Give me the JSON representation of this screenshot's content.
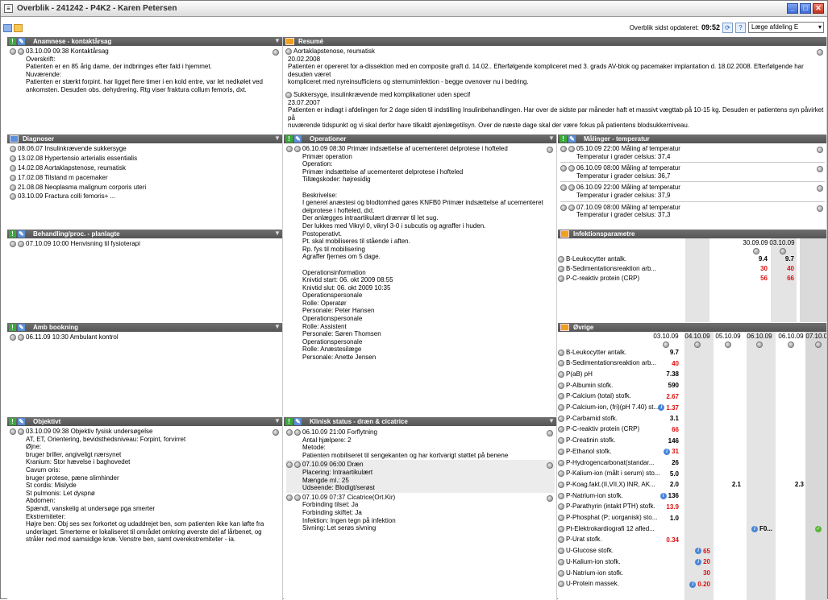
{
  "window": {
    "title": "Overblik - 241242 - P4K2 - Karen Petersen",
    "icon": "form-icon"
  },
  "toolbar": {
    "updated_label": "Overblik sidst opdateret:",
    "updated_time": "09:52",
    "refresh_icon": "refresh-icon",
    "help_label": "?",
    "role_select": "Læge afdeling E"
  },
  "anamnese": {
    "title": "Anamnese - kontaktårsag",
    "head": "03.10.09 09:38 Kontaktårsag",
    "lines": [
      "Overskrift:",
      "Patienten er en 85 årig dame, der indbringes efter fald i hjemmet.",
      "Nuværende:",
      "Patienten er stærkt forpint. har ligget flere timer i en kold entre, var let nedkølet ved",
      "ankomsten. Desuden obs. dehydrering. Rtg viser fraktura collum femoris, dxt."
    ]
  },
  "resume": {
    "title": "Resumé",
    "blocks": [
      {
        "head": "Aortaklapstenose, reumatisk",
        "lines": [
          "20.02.2008",
          "Patienten er opereret for a-dissektion med en composite graft d. 14.02.. Efterfølgende kompliceret med 3. grads AV-blok og pacemaker implantation d. 18.02.2008. Efterfølgende har desuden været",
          "kompliceret med nyreinsufficiens og sternuminfektion - begge ovenover nu i bedring."
        ]
      },
      {
        "head": "Sukkersyge, insulinkrævende med komplikationer uden specif",
        "lines": [
          "23.07.2007",
          "Patienten er indlagt i afdelingen for 2 dage siden til indstilling Insulinbehandlingen. Har over de sidste par måneder haft et massivt vægttab på 10-15 kg. Desuden er patientens syn påvirket på",
          "nuværende tidspunkt og vi skal derfor have tilkaldt øjenlægetilsyn. Over de næste dage skal der være fokus på patientens blodsukkerniveau."
        ]
      }
    ]
  },
  "diagnoser": {
    "title": "Diagnoser",
    "items": [
      "08.06.07 Insulinkrævende sukkersyge",
      "13.02.08 Hypertensio arterialis essentialis",
      "14.02.08 Aortaklapstenose, reumatisk",
      "17.02.08 Tilstand m pacemaker",
      "21.08.08 Neoplasma malignum corporis uteri",
      "03.10.09 Fractura colli femoris+ ..."
    ]
  },
  "operationer": {
    "title": "Operationer",
    "head": "06.10.09 08:30 Primær indsættelse af ucementeret delprotese i hofteled",
    "lines": [
      "Primær operation",
      "Operation:",
      "Primær indsættelse af ucementeret delprotese i hofteled",
      "Tillægskoder: højresidig",
      "",
      "Beskrivelse:",
      "I generel anæstesi og blodtomhed gøres KNFB0 Primær indsættelse af ucementeret",
      "delprotese i hofteled, dxt.",
      "Der anlægges intraartikulært drænrør til let sug.",
      "Der lukkes med Vikryl 0, vikryl 3-0 i subcutis og agraffer i huden.",
      "Postoperativt.",
      "Pt. skal mobiliseres til stående i aften.",
      "Rp. fys til mobilisering",
      "Agraffer fjernes om 5 dage.",
      "",
      "Operationsinformation",
      "Knivtid start: 06. okt 2009 08:55",
      "Knivtid slut: 06. okt 2009 10:35",
      "Operationspersonale",
      "Rolle: Operatør",
      "Personale: Peter Hansen",
      "Operationspersonale",
      "Rolle: Assistent",
      "Personale: Søren Thomsen",
      "Operationspersonale",
      "Rolle: Anæstesilæge",
      "Personale: Anette Jensen"
    ]
  },
  "malinger": {
    "title": "Målinger - temperatur",
    "items": [
      {
        "head": "05.10.09 22:00 Måling af temperatur",
        "detail": "Temperatur i grader celsius: 37,4"
      },
      {
        "head": "06.10.09 08:00 Måling af temperatur",
        "detail": "Temperatur i grader celsius: 36,7"
      },
      {
        "head": "06.10.09 22:00 Måling af temperatur",
        "detail": "Temperatur i grader celsius: 37,9"
      },
      {
        "head": "07.10.09 08:00 Måling af temperatur",
        "detail": "Temperatur i grader celsius: 37,3"
      }
    ]
  },
  "behandling": {
    "title": "Behandling/proc. - planlagte",
    "items": [
      "07.10.09 10:00 Henvisning til fysioterapi"
    ]
  },
  "infektion": {
    "title": "Infektionsparametre",
    "dates": [
      "30.09.09",
      "03.10.09"
    ],
    "rows": [
      {
        "label": "B-Leukocytter antalk.",
        "vals": [
          "9.4",
          "9.7"
        ],
        "red": [
          false,
          false
        ]
      },
      {
        "label": "B-Sedimentationsreaktion arb...",
        "vals": [
          "30",
          "40"
        ],
        "red": [
          true,
          true
        ]
      },
      {
        "label": "P-C-reaktiv protein (CRP)",
        "vals": [
          "56",
          "66"
        ],
        "red": [
          true,
          true
        ]
      }
    ]
  },
  "amb": {
    "title": "Amb bookning",
    "items": [
      "06.11.09 10:30 Ambulant kontrol"
    ]
  },
  "ovrige": {
    "title": "Øvrige",
    "dates": [
      "03.10.09",
      "04.10.09",
      "05.10.09",
      "06.10.09",
      "06.10.09",
      "07.10.09"
    ],
    "rows": [
      {
        "label": "B-Leukocytter antalk.",
        "col": 0,
        "val": "9.7",
        "red": false,
        "info": false
      },
      {
        "label": "B-Sedimentationsreaktion arb...",
        "col": 0,
        "val": "40",
        "red": true,
        "info": false
      },
      {
        "label": "P(aB) pH",
        "col": 0,
        "val": "7.38",
        "red": false,
        "info": false
      },
      {
        "label": "P-Albumin stofk.",
        "col": 0,
        "val": "590",
        "red": false,
        "info": false
      },
      {
        "label": "P-Calcium (total) stofk.",
        "col": 0,
        "val": "2.67",
        "red": true,
        "info": false
      },
      {
        "label": "P-Calcium-ion, (fri)(pH 7.40) st...",
        "col": 0,
        "val": "1.37",
        "red": true,
        "info": true
      },
      {
        "label": "P-Carbamid stofk.",
        "col": 0,
        "val": "3.1",
        "red": false,
        "info": false
      },
      {
        "label": "P-C-reaktiv protein (CRP)",
        "col": 0,
        "val": "66",
        "red": true,
        "info": false
      },
      {
        "label": "P-Creatinin stofk.",
        "col": 0,
        "val": "146",
        "red": false,
        "info": false
      },
      {
        "label": "P-Ethanol stofk.",
        "col": 0,
        "val": "31",
        "red": true,
        "info": true
      },
      {
        "label": "P-Hydrogencarbonat(standar...",
        "col": 0,
        "val": "26",
        "red": false,
        "info": false
      },
      {
        "label": "P-Kalium-ion (målt i serum) sto...",
        "col": 0,
        "val": "5.0",
        "red": false,
        "info": false
      },
      {
        "label": "P-Koag.fakt.(II,VII,X) INR, AK...",
        "col": 0,
        "val": "2.0",
        "red": false,
        "info": false,
        "extra": [
          {
            "col": 2,
            "val": "2.1"
          },
          {
            "col": 4,
            "val": "2.3"
          }
        ]
      },
      {
        "label": "P-Natrium-ion stofk.",
        "col": 0,
        "val": "136",
        "red": false,
        "info": true
      },
      {
        "label": "P-Parathyrin (intakt PTH) stofk.",
        "col": 0,
        "val": "13.9",
        "red": true,
        "info": false
      },
      {
        "label": "P-Phosphat (P; uorganisk) sto...",
        "col": 0,
        "val": "1.0",
        "red": false,
        "info": false
      },
      {
        "label": "Pt-Elektrokardiografi 12 afled...",
        "col": 3,
        "val": "F0...",
        "red": false,
        "info": true,
        "check": 5
      },
      {
        "label": "P-Urat stofk.",
        "col": 0,
        "val": "0.34",
        "red": true,
        "info": false
      },
      {
        "label": "U-Glucose stofk.",
        "col": 1,
        "val": "65",
        "red": true,
        "info": true
      },
      {
        "label": "U-Kalium-ion stofk.",
        "col": 1,
        "val": "20",
        "red": true,
        "info": true
      },
      {
        "label": "U-Natrium-ion stofk.",
        "col": 1,
        "val": "30",
        "red": true,
        "info": false
      },
      {
        "label": "U-Protein massek.",
        "col": 1,
        "val": "0.20",
        "red": true,
        "info": true
      }
    ]
  },
  "objektivt": {
    "title": "Objektivt",
    "head": "03.10.09 09:38 Objektiv fysisk undersøgelse",
    "lines": [
      "AT, ET, Orientering, bevidsthedsniveau: Forpint, forvirret",
      "Øjne:",
      "bruger briller, angiveligt nærsynet",
      "Kranium: Stor hævelse i baghovedet",
      "Cavum oris:",
      "bruger protese, pæne slimhinder",
      "St cordis: Mislyde",
      "St pulmonis: Let dyspnø",
      "Abdomen:",
      "Spændt, vanskelig at undersøge pga smerter",
      "Ekstremiteter:",
      "Højre ben: Obj ses sex forkortet og udaddrejet ben, som patienten ikke kan løfte fra",
      "underlaget. Smerterne er lokaliseret til området omkring øverste del af lårbenet, og",
      "stråler ned mod samsidige knæ. Venstre ben, samt overekstremiteter - ia."
    ]
  },
  "klinisk": {
    "title": "Klinisk status - dræn & cicatrice",
    "entries": [
      {
        "head": "06.10.09 21:00 Forflytning",
        "lines": [
          "Antal hjælpere: 2",
          "Metode:",
          "Patienten mobiliseret til sengekanten og har kortvarigt støttet på benene"
        ],
        "shade": false
      },
      {
        "head": "07.10.09 06:00 Dræn",
        "lines": [
          "Placering: Intraartikulært",
          "Mængde ml.: 25",
          "Udseende: Blodigt/serøst"
        ],
        "shade": true
      },
      {
        "head": "07.10.09 07:37 Cicatrice(Ort.Kir)",
        "lines": [
          "Forbinding tilset: Ja",
          "Forbinding skiftet: Ja",
          "Infektion: Ingen tegn på infektion",
          "Sivning: Let serøs sivning"
        ],
        "shade": false
      }
    ]
  },
  "colors": {
    "header": "#5f5f5f",
    "red_value": "#d11111",
    "shaded_column": "#e4e4e4"
  }
}
